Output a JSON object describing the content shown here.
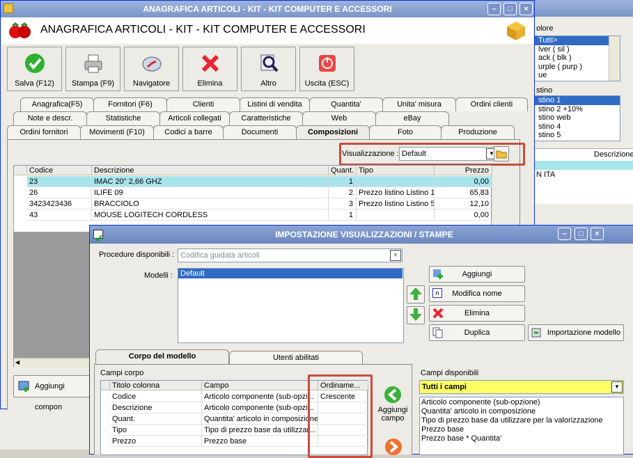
{
  "bg_window": {
    "colore_label": "olore",
    "colore_items": [
      "Tutti>",
      "lver ( sil )",
      "ack ( blk )",
      "urple ( purp )",
      "ue"
    ],
    "listino_label": "stino",
    "listino_items": [
      "stino 1",
      "stino 2 +10%",
      "stino web",
      "stino 4",
      "stino 5"
    ],
    "col_descrizione": "Descrizione",
    "row_text": "N ITA"
  },
  "main": {
    "title": "ANAGRAFICA ARTICOLI - KIT - KIT COMPUTER E ACCESSORI",
    "header_title": "ANAGRAFICA ARTICOLI - KIT - KIT COMPUTER E ACCESSORI",
    "toolbar": [
      {
        "label": "Salva (F12)",
        "icon": "check-icon"
      },
      {
        "label": "Stampa (F9)",
        "icon": "printer-icon"
      },
      {
        "label": "Navigatore",
        "icon": "compass-icon"
      },
      {
        "label": "Elimina",
        "icon": "delete-x-icon"
      },
      {
        "label": "Altro",
        "icon": "search-doc-icon"
      },
      {
        "label": "Uscita (ESC)",
        "icon": "exit-icon"
      }
    ],
    "tabs_row1": [
      "Anagrafica(F5)",
      "Fornitori (F6)",
      "Clienti",
      "Listini di vendita",
      "Quantita'",
      "Unita' misura",
      "Ordini clienti"
    ],
    "tabs_row2": [
      "Note e descr.",
      "Statistiche",
      "Articoli collegati",
      "Caratteristiche",
      "Web",
      "eBay"
    ],
    "tabs_row3": [
      "Ordini fornitori",
      "Movimenti (F10)",
      "Codici a barre",
      "Documenti",
      "Composizioni",
      "Foto",
      "Produzione"
    ],
    "visualizzazione_label": "Visualizzazione :",
    "visualizzazione_value": "Default",
    "grid_headers": [
      "Codice",
      "Descrizione",
      "Quant.",
      "Tipo",
      "Prezzo"
    ],
    "grid_rows": [
      [
        "23",
        "IMAC 20\" 2,66 GHZ",
        "1",
        "",
        "0,00"
      ],
      [
        "26",
        "ILIFE 09",
        "2",
        "Prezzo listino Listino 1",
        "65,83"
      ],
      [
        "3423423436",
        "BRACCIOLO",
        "3",
        "Prezzo listino Listino 5",
        "12,10"
      ],
      [
        "43",
        "MOUSE LOGITECH CORDLESS",
        "1",
        "",
        "0,00"
      ]
    ],
    "add_button": "Aggiungi compon"
  },
  "dialog": {
    "title": "IMPOSTAZIONE VISUALIZZAZIONI / STAMPE",
    "procedure_label": "Procedure disponibili :",
    "procedure_value": "Codifica guidata articoli",
    "modelli_label": "Modelli :",
    "modelli_items": [
      "Default"
    ],
    "btn_aggiungi": "Aggiungi",
    "btn_modifica": "Modifica nome",
    "btn_elimina": "Elimina",
    "btn_duplica": "Duplica",
    "btn_importazione": "Importazione modello",
    "tab_corpo": "Corpo del modello",
    "tab_utenti": "Utenti abilitati",
    "campi_corpo_label": "Campi corpo",
    "campi_headers": [
      "Titolo colonna",
      "Campo",
      "Ordiname..."
    ],
    "campi_rows": [
      [
        "Codice",
        "Articolo componente (sub-opzi...",
        "Crescente"
      ],
      [
        "Descrizione",
        "Articolo componente (sub-opzi...",
        ""
      ],
      [
        "Quant.",
        "Quantita' articolo in composizione",
        ""
      ],
      [
        "Tipo",
        "Tipo di prezzo base da utilizzar...",
        ""
      ],
      [
        "Prezzo",
        "Prezzo base",
        ""
      ]
    ],
    "aggiungi_campo": "Aggiungi campo",
    "campi_disponibili_label": "Campi disponibili",
    "campi_disponibili_value": "Tutti i campi",
    "campi_disponibili_items": [
      "Articolo componente (sub-opzione)",
      "Quantita' articolo in composizione",
      "Tipo di prezzo base da utilizzare per la valorizzazione",
      "Prezzo base",
      "Prezzo base * Quantita'"
    ]
  }
}
